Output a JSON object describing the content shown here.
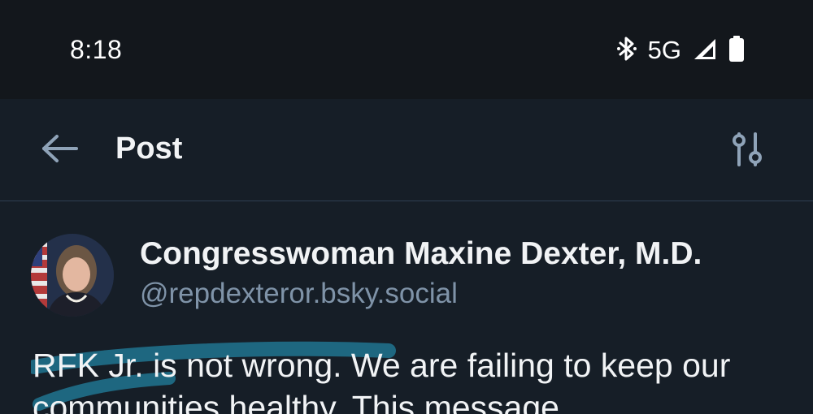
{
  "status_bar": {
    "time": "8:18",
    "network": "5G",
    "icons": [
      "bluetooth-icon",
      "signal-icon",
      "battery-icon"
    ]
  },
  "header": {
    "title": "Post",
    "back_icon": "arrow-left-icon",
    "filter_icon": "sliders-icon"
  },
  "post": {
    "author_name": "Congresswoman Maxine Dexter, M.D.",
    "handle": "@repdexteror.bsky.social",
    "text": "RFK Jr. is not wrong. We are failing to keep our communities healthy. This message"
  },
  "colors": {
    "background": "#161e27",
    "status_bar": "#13171c",
    "handle": "#7f93a8",
    "divider": "#2e3f51",
    "highlight": "#1f6f8b"
  }
}
